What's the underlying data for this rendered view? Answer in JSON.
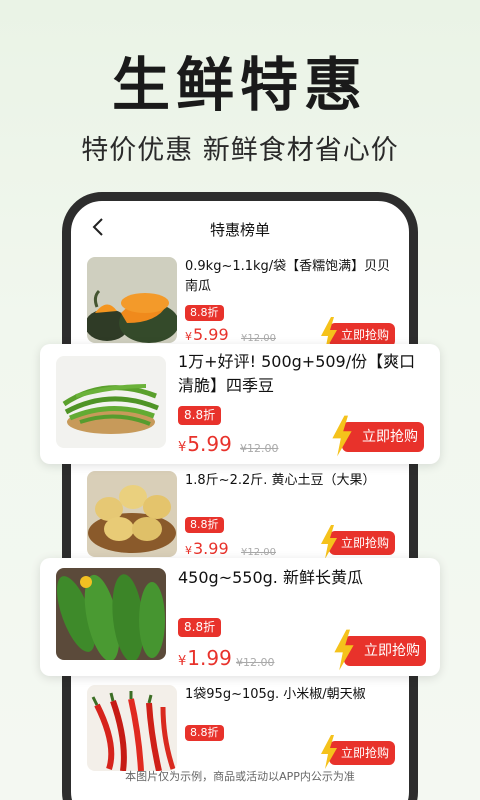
{
  "hero": {
    "title": "生鲜特惠",
    "subtitle": "特价优惠 新鲜食材省心价"
  },
  "phone": {
    "title": "特惠榜单",
    "items": [
      {
        "name": "0.9kg~1.1kg/袋【香糯饱满】贝贝南瓜",
        "tag": "8.8折",
        "yen": "¥",
        "price": "5.99",
        "orig": "¥12.00",
        "buy": "立即抢购",
        "image": "pumpkin"
      },
      {
        "name": "1.8斤~2.2斤. 黄心土豆（大果）",
        "tag": "8.8折",
        "yen": "¥",
        "price": "3.99",
        "orig": "¥12.00",
        "buy": "立即抢购",
        "image": "potato"
      },
      {
        "name": "1袋95g~105g. 小米椒/朝天椒",
        "tag": "8.8折",
        "buy": "立即抢购",
        "image": "chili"
      }
    ]
  },
  "cards": [
    {
      "name": "1万+好评! 500g+509/份【爽口清脆】四季豆",
      "tag": "8.8折",
      "yen": "¥",
      "price": "5.99",
      "orig": "¥12.00",
      "buy": "立即抢购",
      "image": "green-beans"
    },
    {
      "name": "450g~550g. 新鲜长黄瓜",
      "tag": "8.8折",
      "yen": "¥",
      "price": "1.99",
      "orig": "¥12.00",
      "buy": "立即抢购",
      "image": "cucumber"
    }
  ],
  "footnote": "本图片仅为示例，商品或活动以APP内公示为准",
  "colors": {
    "accent": "#e8322b",
    "bolt": "#f5c21b"
  }
}
